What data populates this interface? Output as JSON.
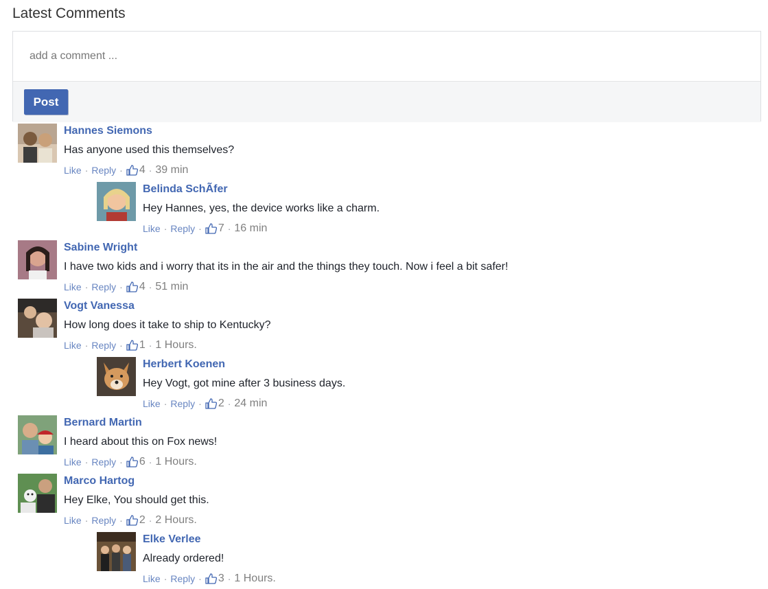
{
  "header": {
    "title": "Latest Comments"
  },
  "composer": {
    "placeholder": "add a comment ...",
    "post_label": "Post"
  },
  "actions": {
    "like": "Like",
    "reply": "Reply",
    "sep": "·"
  },
  "comments": [
    {
      "name": "Hannes Siemons",
      "text": "Has anyone used this themselves?",
      "likes": "4",
      "time": "39 min"
    },
    {
      "name": "Belinda SchÃfer",
      "text": "Hey Hannes, yes, the device works like a charm.",
      "likes": "7",
      "time": "16 min"
    },
    {
      "name": "Sabine Wright",
      "text": "I have two kids and i worry that its in the air and the things they touch. Now i feel a bit safer!",
      "likes": "4",
      "time": "51 min"
    },
    {
      "name": "Vogt Vanessa",
      "text": "How long does it take to ship to Kentucky?",
      "likes": "1",
      "time": "1 Hours."
    },
    {
      "name": "Herbert Koenen",
      "text": "Hey Vogt, got mine after 3 business days.",
      "likes": "2",
      "time": "24 min"
    },
    {
      "name": "Bernard Martin",
      "text": "I heard about this on Fox news!",
      "likes": "6",
      "time": "1 Hours."
    },
    {
      "name": "Marco Hartog",
      "text": "Hey Elke, You should get this.",
      "likes": "2",
      "time": "2 Hours."
    },
    {
      "name": "Elke Verlee",
      "text": "Already ordered!",
      "likes": "3",
      "time": "1 Hours."
    }
  ],
  "icons": {
    "like": "thumbs-up-icon"
  },
  "colors": {
    "link": "#4267b2",
    "button": "#4267b2",
    "meta": "#90949c"
  }
}
